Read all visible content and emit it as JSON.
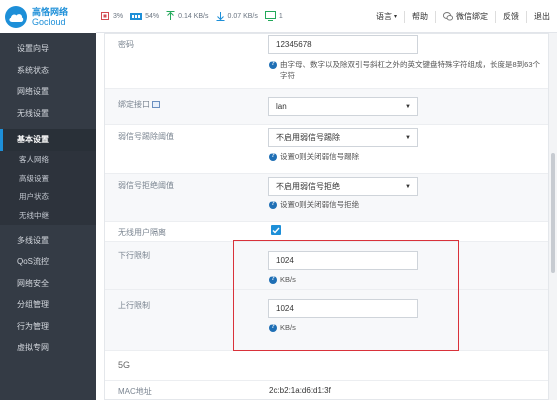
{
  "brand": {
    "name_cn": "高恪网络",
    "name_en": "Gocloud"
  },
  "stats": {
    "cpu": "3%",
    "mem": "54%",
    "upload": "0.14 KB/s",
    "download": "0.07 KB/s",
    "users": "1"
  },
  "topnav": [
    "语言",
    "帮助",
    "微信绑定",
    "反馈",
    "退出"
  ],
  "sidebar": {
    "items_top": [
      "设置向导",
      "系统状态",
      "网络设置",
      "无线设置"
    ],
    "active": "基本设置",
    "subitems": [
      "客人网络",
      "高级设置",
      "用户状态",
      "无线中继"
    ],
    "items_bottom": [
      "多线设置",
      "QoS流控",
      "网络安全",
      "分组管理",
      "行为管理",
      "虚拟专网"
    ]
  },
  "form": {
    "password": {
      "label": "密码",
      "value": "12345678",
      "help": "由字母、数字以及除双引号斜杠之外的英文键盘特殊字符组成，长度是8到63个字符"
    },
    "bind_iface": {
      "label": "绑定接口",
      "value": "lan"
    },
    "weak_kick": {
      "label": "弱信号踢除阈值",
      "value": "不启用弱信号踢除",
      "help": "设置0则关闭弱信号踢除"
    },
    "weak_reject": {
      "label": "弱信号拒绝阈值",
      "value": "不启用弱信号拒绝",
      "help": "设置0则关闭弱信号拒绝"
    },
    "isolation": {
      "label": "无线用户隔离",
      "checked": true
    },
    "down_limit": {
      "label": "下行限制",
      "value": "1024",
      "unit": "KB/s"
    },
    "up_limit": {
      "label": "上行限制",
      "value": "1024",
      "unit": "KB/s"
    },
    "section_5g": "5G",
    "mac": {
      "label": "MAC地址",
      "value": "2c:b2:1a:d6:d1:3f"
    }
  }
}
